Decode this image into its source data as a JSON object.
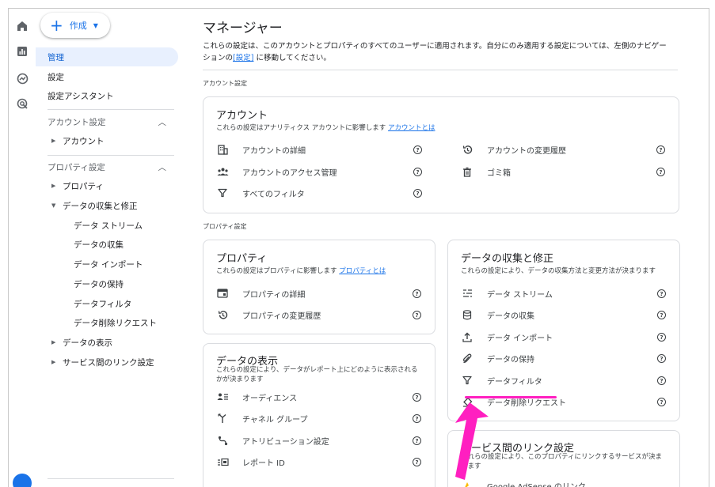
{
  "create": {
    "label": "作成"
  },
  "nav": {
    "admin": "管理",
    "settings": "設定",
    "assistant": "設定アシスタント",
    "account_section": "アカウント設定",
    "account": "アカウント",
    "property_section": "プロパティ設定",
    "property": "プロパティ",
    "data_collection": "データの収集と修正",
    "sub": [
      "データ ストリーム",
      "データの収集",
      "データ インポート",
      "データの保持",
      "データフィルタ",
      "データ削除リクエスト"
    ],
    "data_display": "データの表示",
    "service_links": "サービス間のリンク設定"
  },
  "page": {
    "title": "マネージャー",
    "desc_1": "これらの設定は、このアカウントとプロパティのすべてのユーザーに適用されます。自分にのみ適用する設定については、左側のナビゲー",
    "desc_2a": "ションの",
    "desc_link": "[設定]",
    "desc_2b": " に移動してください。"
  },
  "account_label": "アカウント設定",
  "account_card": {
    "title": "アカウント",
    "desc": "これらの設定はアナリティクス アカウントに影響します",
    "link": "アカウントとは",
    "rows": [
      "アカウントの詳細",
      "アカウントの変更履歴",
      "アカウントのアクセス管理",
      "ゴミ箱",
      "すべてのフィルタ"
    ]
  },
  "property_label": "プロパティ設定",
  "property_card": {
    "title": "プロパティ",
    "desc": "これらの設定はプロパティに影響します",
    "link": "プロパティとは",
    "rows": [
      "プロパティの詳細",
      "プロパティの変更履歴"
    ]
  },
  "collection_card": {
    "title": "データの収集と修正",
    "desc": "これらの設定により、データの収集方法と変更方法が決まります",
    "rows": [
      "データ ストリーム",
      "データの収集",
      "データ インポート",
      "データの保持",
      "データフィルタ",
      "データ削除リクエスト"
    ]
  },
  "display_card": {
    "title": "データの表示",
    "desc_1": "これらの設定により、データがレポート上にどのように表示される",
    "desc_2": "かが決まります",
    "rows": [
      "オーディエンス",
      "チャネル グループ",
      "アトリビューション設定",
      "レポート ID"
    ]
  },
  "links_card": {
    "title": "サービス間のリンク設定",
    "desc_1": "これらの設定により、このプロパティにリンクするサービスが決ま",
    "desc_2": "ります",
    "row_partial": "Google AdSense のリンク"
  },
  "help_glyph": "?",
  "colors": {
    "accent": "#1a73e8",
    "highlight": "#ff1fc0",
    "active_bg": "#e8f0fe"
  }
}
